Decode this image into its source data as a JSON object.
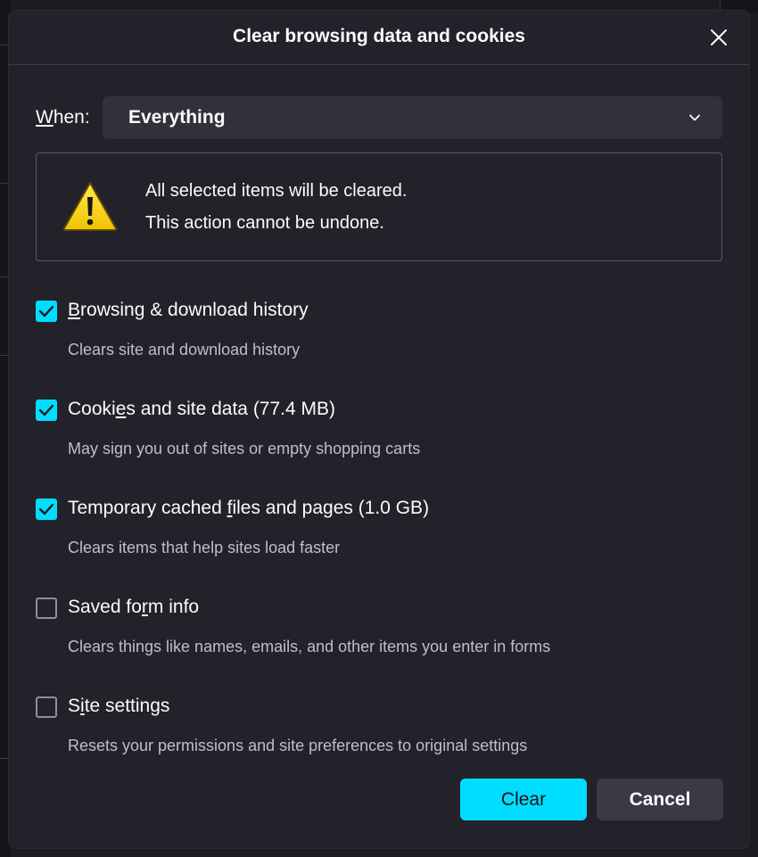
{
  "dialog": {
    "title": "Clear browsing data and cookies",
    "close_icon": "close-icon"
  },
  "when": {
    "label_prefix": "W",
    "label_rest": "hen:",
    "selected": "Everything"
  },
  "warning": {
    "icon": "warning-icon",
    "line1": "All selected items will be cleared.",
    "line2": "This action cannot be undone."
  },
  "options": [
    {
      "label_pre": "",
      "label_u": "B",
      "label_post": "rowsing & download history",
      "description": "Clears site and download history",
      "checked": true
    },
    {
      "label_pre": "Cooki",
      "label_u": "e",
      "label_post": "s and site data (77.4 MB)",
      "description": "May sign you out of sites or empty shopping carts",
      "checked": true
    },
    {
      "label_pre": "Temporary cached ",
      "label_u": "f",
      "label_post": "iles and pages (1.0 GB)",
      "description": "Clears items that help sites load faster",
      "checked": true
    },
    {
      "label_pre": "Saved fo",
      "label_u": "r",
      "label_post": "m info",
      "description": "Clears things like names, emails, and other items you enter in forms",
      "checked": false
    },
    {
      "label_pre": "S",
      "label_u": "i",
      "label_post": "te settings",
      "description": "Resets your permissions and site preferences to original settings",
      "checked": false
    }
  ],
  "buttons": {
    "clear": "Clear",
    "cancel": "Cancel"
  },
  "colors": {
    "accent": "#00ddff",
    "dialog_bg": "#23222b",
    "text": "#fbfbfe",
    "muted": "#bfbfc9"
  }
}
